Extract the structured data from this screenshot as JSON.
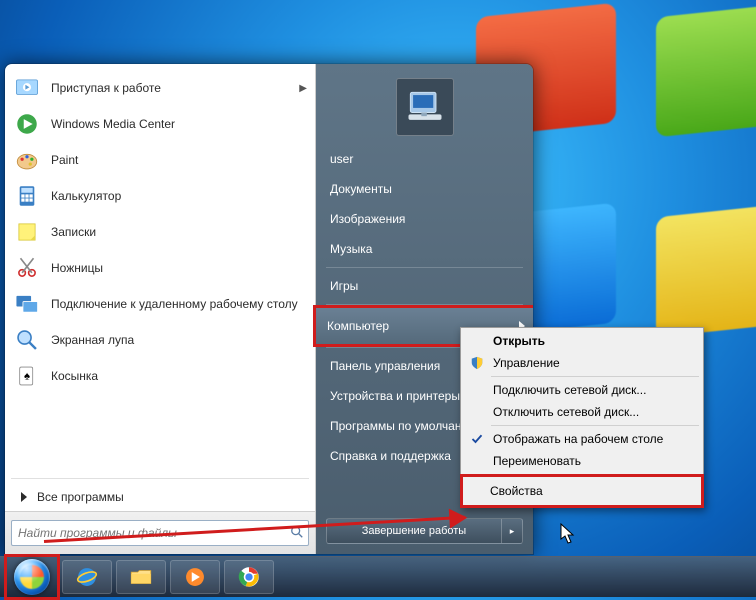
{
  "programs": [
    {
      "label": "Приступая к работе",
      "icon": "getting-started",
      "arrow": true
    },
    {
      "label": "Windows Media Center",
      "icon": "media-center"
    },
    {
      "label": "Paint",
      "icon": "paint"
    },
    {
      "label": "Калькулятор",
      "icon": "calculator"
    },
    {
      "label": "Записки",
      "icon": "sticky-notes"
    },
    {
      "label": "Ножницы",
      "icon": "snipping"
    },
    {
      "label": "Подключение к удаленному рабочему столу",
      "icon": "rdp"
    },
    {
      "label": "Экранная лупа",
      "icon": "magnifier"
    },
    {
      "label": "Косынка",
      "icon": "solitaire"
    }
  ],
  "all_programs": "Все программы",
  "search": {
    "placeholder": "Найти программы и файлы"
  },
  "right": {
    "user": "user",
    "items": [
      {
        "label": "Документы"
      },
      {
        "label": "Изображения"
      },
      {
        "label": "Музыка"
      },
      {
        "sep": true
      },
      {
        "label": "Игры"
      },
      {
        "sep": true
      },
      {
        "label": "Компьютер",
        "hl": true
      },
      {
        "sep": true
      },
      {
        "label": "Панель управления"
      },
      {
        "label": "Устройства и принтеры"
      },
      {
        "label": "Программы по умолчанию"
      },
      {
        "label": "Справка и поддержка"
      }
    ],
    "shutdown": "Завершение работы"
  },
  "context": [
    {
      "label": "Открыть",
      "bold": true
    },
    {
      "label": "Управление",
      "icon": "shield"
    },
    {
      "sep": true
    },
    {
      "label": "Подключить сетевой диск..."
    },
    {
      "label": "Отключить сетевой диск..."
    },
    {
      "sep": true
    },
    {
      "label": "Отображать на рабочем столе",
      "icon": "check"
    },
    {
      "label": "Переименовать"
    },
    {
      "sep": true
    },
    {
      "label": "Свойства",
      "hl": true
    }
  ]
}
